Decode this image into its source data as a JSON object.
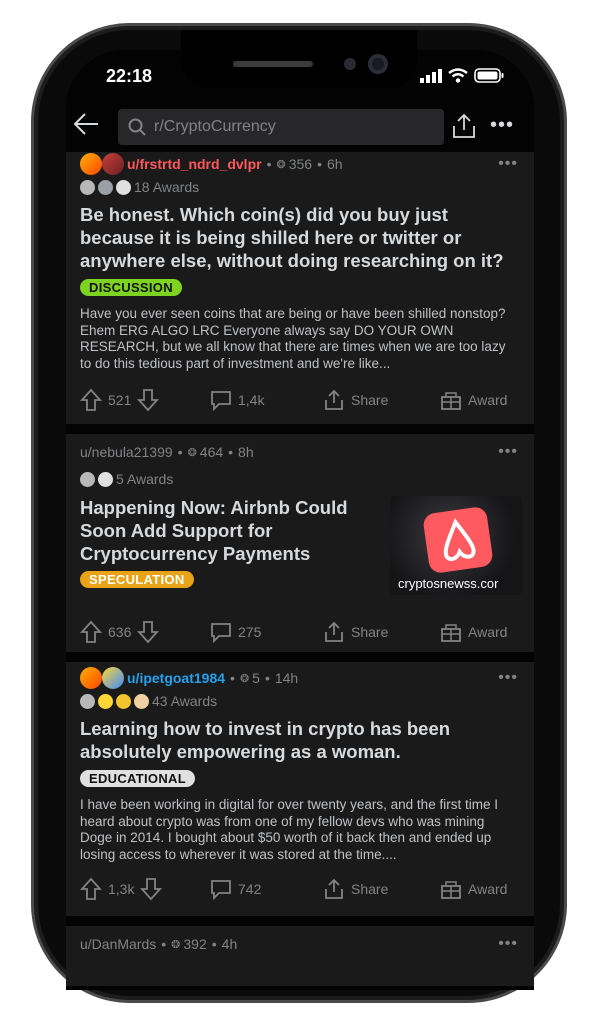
{
  "status_bar": {
    "time": "22:18"
  },
  "search": {
    "placeholder": "r/CryptoCurrency"
  },
  "posts": [
    {
      "user": "u/frstrtd_ndrd_dvlpr",
      "karma": "356",
      "age": "6h",
      "awards": "18 Awards",
      "title": "Be honest. Which coin(s) did you buy just because it is being shilled here or twitter or anywhere else, without doing researching on it?",
      "flair": "DISCUSSION",
      "flair_color": "#7ed321",
      "body": "Have you ever seen coins that are being or have been shilled nonstop? Ehem ERG ALGO LRC Everyone always say DO YOUR OWN RESEARCH, but we all know that there are times when we are too lazy to do this tedious part of investment and we're like...",
      "votes": "521",
      "comments": "1,4k",
      "share": "Share",
      "award": "Award"
    },
    {
      "user": "u/nebula21399",
      "karma": "464",
      "age": "8h",
      "awards": "5 Awards",
      "title": "Happening Now: Airbnb Could Soon Add Support for Cryptocurrency Payments",
      "flair": "SPECULATION",
      "flair_color": "#e8a316",
      "thumb_caption": "cryptosnewss.cor",
      "votes": "636",
      "comments": "275",
      "share": "Share",
      "award": "Award"
    },
    {
      "user": "u/ipetgoat1984",
      "karma": "5",
      "age": "14h",
      "awards": "43 Awards",
      "title": "Learning how to invest in crypto has been absolutely empowering as a woman.",
      "flair": "EDUCATIONAL",
      "flair_color": "#e0e0e0",
      "body": "I have been working in digital for over twenty years, and the first time I heard about crypto was from one of my fellow devs who was mining Doge in 2014. I bought about $50 worth of it back then and ended up losing access to wherever it was stored at the time....",
      "votes": "1,3k",
      "comments": "742",
      "share": "Share",
      "award": "Award"
    },
    {
      "user": "u/DanMards",
      "karma": "392",
      "age": "4h"
    }
  ]
}
